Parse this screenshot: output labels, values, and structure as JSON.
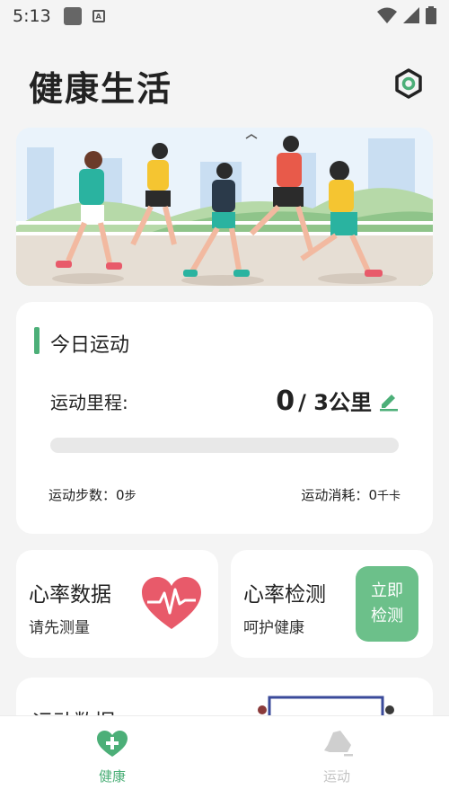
{
  "status_bar": {
    "time": "5:13",
    "a_glyph": "A"
  },
  "header": {
    "title": "健康生活",
    "settings_icon": "settings-icon"
  },
  "today": {
    "title": "今日运动",
    "distance_label": "运动里程:",
    "distance_current": "0",
    "distance_goal": "/ 3公里",
    "progress": 0,
    "steps_label": "运动步数：",
    "steps_value": "0",
    "steps_unit": "步",
    "kcal_label": "运动消耗：",
    "kcal_value": "0",
    "kcal_unit": "千卡"
  },
  "heart_card": {
    "title": "心率数据",
    "subtitle": "请先测量"
  },
  "check_card": {
    "title": "心率检测",
    "subtitle": "呵护健康",
    "button_line1": "立即",
    "button_line2": "检测"
  },
  "data_card": {
    "title": "运动数据"
  },
  "nav": {
    "items": [
      {
        "label": "健康",
        "active": true,
        "icon": "heart-plus-icon"
      },
      {
        "label": "运动",
        "active": false,
        "icon": "sneaker-icon"
      }
    ]
  },
  "colors": {
    "accent": "#4caf78",
    "heart": "#e85a6a",
    "button": "#6cc08a"
  }
}
